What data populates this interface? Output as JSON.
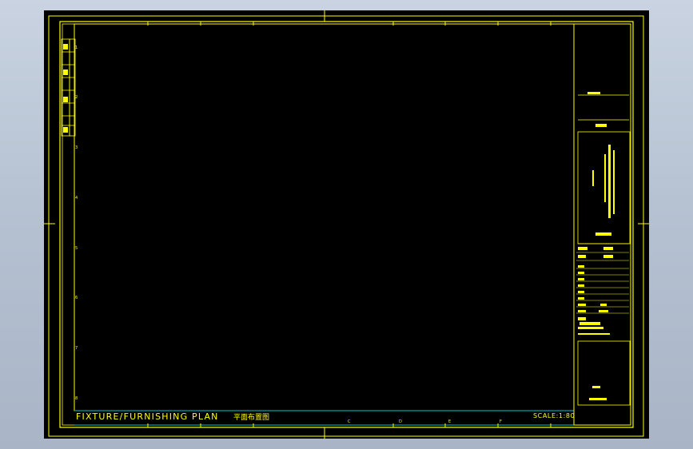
{
  "drawing": {
    "title": "FIXTURE/FURNISHING PLAN",
    "title_cn": "平面布置图",
    "scale": "SCALE:1:80"
  },
  "colors": {
    "background": "#000000",
    "frame": "#ffff00",
    "accent": "#00c8c8",
    "outer": "#b8c4d4"
  },
  "grid_labels": {
    "left": [
      "1",
      "2",
      "3",
      "4",
      "5",
      "6",
      "7",
      "8"
    ],
    "bottom": [
      "C",
      "D",
      "E",
      "F"
    ]
  }
}
